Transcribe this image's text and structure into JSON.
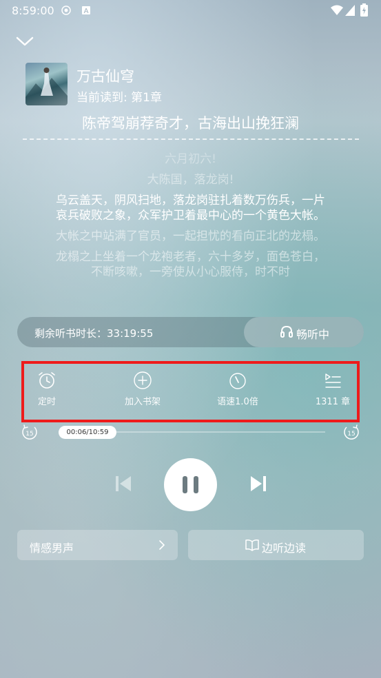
{
  "status_bar": {
    "time": "8:59:00"
  },
  "book": {
    "title": "万古仙穹",
    "current_read": "当前读到: 第1章",
    "chapter_title": "陈帝驾崩荐奇才，古海出山挽狂澜"
  },
  "text": {
    "paragraphs": [
      "六月初六!",
      "大陈国，落龙岗!",
      "乌云盖天，阴风扫地，落龙岗驻扎着数万伤兵，一片哀兵破败之象，众军护卫着最中心的一个黄色大帐。",
      "大帐之中站满了官员，一起担忧的看向正北的龙榻。",
      "龙榻之上坐着一个龙袍老者，六十多岁，面色苍白，不断咳嗽，一旁使从小心服侍，时不时"
    ],
    "active_index": 2
  },
  "listen": {
    "remaining_label": "剩余听书时长：33:19:55",
    "listening_label": "畅听中"
  },
  "functions": {
    "timer_label": "定时",
    "add_shelf_label": "加入书架",
    "speed_label": "语速1.0倍",
    "chapters_label": "1311 章"
  },
  "progress": {
    "time_text": "00:06/10:59",
    "rewind_seconds": "15",
    "forward_seconds": "15",
    "fraction": 0.009
  },
  "bottom": {
    "voice_label": "情感男声",
    "read_along_label": "边听边读"
  }
}
